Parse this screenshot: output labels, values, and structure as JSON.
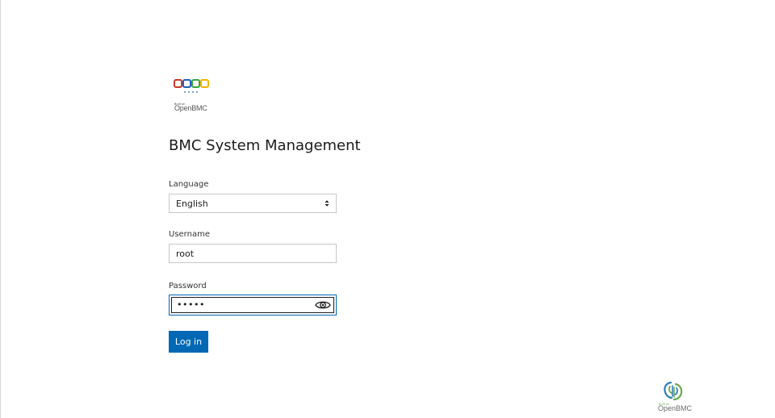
{
  "branding": {
    "built_on_text": "Built on",
    "openbmc_text": "OpenBMC"
  },
  "page": {
    "title": "BMC System Management"
  },
  "form": {
    "language": {
      "label": "Language",
      "selected": "English"
    },
    "username": {
      "label": "Username",
      "value": "root"
    },
    "password": {
      "label": "Password",
      "masked_value": "•••••"
    },
    "login_button_label": "Log in"
  },
  "footer": {
    "built_on_text": "Built on",
    "openbmc_text": "OpenBMC"
  },
  "colors": {
    "primary": "#0068b5",
    "logo_red": "#c8372d",
    "logo_blue": "#1f5fbf",
    "logo_green": "#3aa245",
    "logo_yellow": "#f2b300",
    "openbmc_green": "#6aa84f",
    "openbmc_blue": "#2d7fb8"
  },
  "icons": {
    "select_arrow": "chevron-up-down-icon",
    "password_toggle": "eye-icon"
  }
}
